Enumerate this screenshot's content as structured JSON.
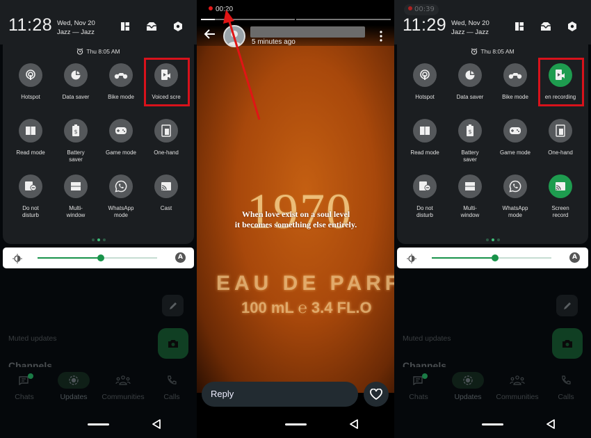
{
  "panels": [
    {
      "id": "left",
      "recording_chip": null,
      "clock": "11:28",
      "date": "Wed, Nov 20",
      "carrier": "Jazz — Jazz",
      "header_icons": [
        "edit-tiles-icon",
        "inbox-icon",
        "settings-icon"
      ],
      "alarm": "Thu 8:05 AM",
      "tiles": [
        {
          "label": "Hotspot",
          "icon": "hotspot-icon",
          "on": false
        },
        {
          "label": "Data saver",
          "icon": "data-saver-icon",
          "on": false
        },
        {
          "label": "Bike mode",
          "icon": "bike-icon",
          "on": false
        },
        {
          "label": "Voiced scre",
          "icon": "voiced-screen-recording-icon",
          "on": false,
          "highlighted": true
        },
        {
          "label": "Read mode",
          "icon": "read-mode-icon",
          "on": false
        },
        {
          "label": "Battery\nsaver",
          "icon": "battery-saver-icon",
          "on": false
        },
        {
          "label": "Game mode",
          "icon": "gamepad-icon",
          "on": false
        },
        {
          "label": "One-hand",
          "icon": "one-hand-icon",
          "on": false
        },
        {
          "label": "Do not\ndisturb",
          "icon": "do-not-disturb-icon",
          "on": false
        },
        {
          "label": "Multi-\nwindow",
          "icon": "multi-window-icon",
          "on": false
        },
        {
          "label": "WhatsApp\nmode",
          "icon": "whatsapp-icon",
          "on": false
        },
        {
          "label": "Cast",
          "icon": "cast-icon",
          "on": false
        }
      ],
      "page_indicator": {
        "count": 3,
        "active": 1
      },
      "brightness": 0.53,
      "background": {
        "muted_updates": "Muted updates",
        "channels": "Channels",
        "nav": [
          {
            "label": "Chats",
            "icon": "chats-icon",
            "badge": true
          },
          {
            "label": "Updates",
            "icon": "updates-icon",
            "selected": true
          },
          {
            "label": "Communities",
            "icon": "communities-icon"
          },
          {
            "label": "Calls",
            "icon": "calls-icon"
          }
        ]
      }
    },
    {
      "id": "right",
      "recording_chip": "00:39",
      "clock": "11:29",
      "date": "Wed, Nov 20",
      "carrier": "Jazz — Jazz",
      "header_icons": [
        "edit-tiles-icon",
        "inbox-icon",
        "settings-icon"
      ],
      "alarm": "Thu 8:05 AM",
      "tiles": [
        {
          "label": "Hotspot",
          "icon": "hotspot-icon",
          "on": false
        },
        {
          "label": "Data saver",
          "icon": "data-saver-icon",
          "on": false
        },
        {
          "label": "Bike mode",
          "icon": "bike-icon",
          "on": false
        },
        {
          "label": "en recording",
          "icon": "voiced-screen-recording-icon",
          "on": true,
          "highlighted": true
        },
        {
          "label": "Read mode",
          "icon": "read-mode-icon",
          "on": false
        },
        {
          "label": "Battery\nsaver",
          "icon": "battery-saver-icon",
          "on": false
        },
        {
          "label": "Game mode",
          "icon": "gamepad-icon",
          "on": false
        },
        {
          "label": "One-hand",
          "icon": "one-hand-icon",
          "on": false
        },
        {
          "label": "Do not\ndisturb",
          "icon": "do-not-disturb-icon",
          "on": false
        },
        {
          "label": "Multi-\nwindow",
          "icon": "multi-window-icon",
          "on": false
        },
        {
          "label": "WhatsApp\nmode",
          "icon": "whatsapp-icon",
          "on": false
        },
        {
          "label": "Screen\nrecord",
          "icon": "cast-icon",
          "on": true
        }
      ],
      "page_indicator": {
        "count": 3,
        "active": 1
      },
      "brightness": 0.53,
      "background": {
        "muted_updates": "Muted updates",
        "channels": "Channels",
        "nav": [
          {
            "label": "Chats",
            "icon": "chats-icon",
            "badge": true
          },
          {
            "label": "Updates",
            "icon": "updates-icon",
            "selected": true
          },
          {
            "label": "Communities",
            "icon": "communities-icon"
          },
          {
            "label": "Calls",
            "icon": "calls-icon"
          }
        ]
      }
    }
  ],
  "story": {
    "recording_time": "00:20",
    "progress": [
      0.15,
      0,
      0
    ],
    "posted": "5 minutes ago",
    "image_text": {
      "year": "1970",
      "line1": "EAU DE PARFU",
      "line2": "100 mL ℮ 3.4 FL.O"
    },
    "caption": "When love exist on a soul level\nit becomes something else entirely.",
    "reply_placeholder": "Reply"
  },
  "colors": {
    "accent": "#1e9c4f",
    "highlight": "#d8121b",
    "tile_off": "#55585b"
  }
}
